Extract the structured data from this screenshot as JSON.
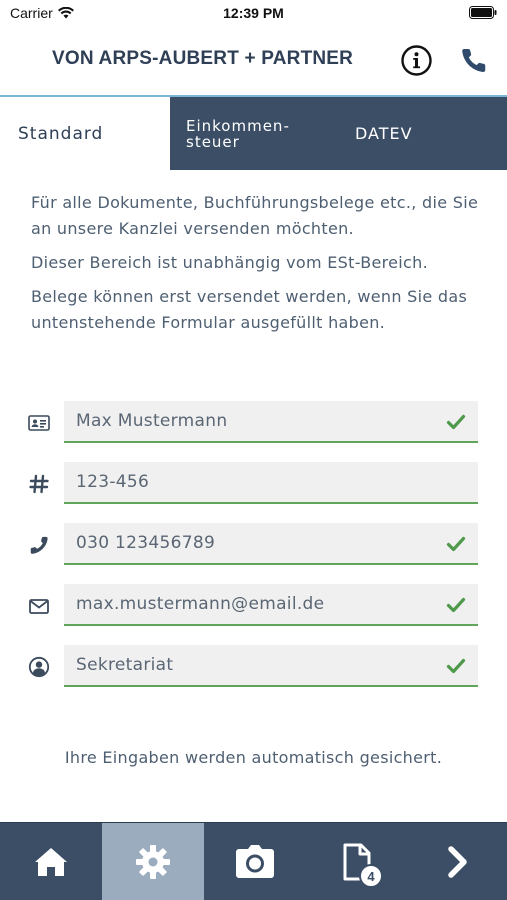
{
  "status_bar": {
    "carrier": "Carrier",
    "time": "12:39 PM"
  },
  "header": {
    "brand": "VON ARPS-AUBERT + PARTNER",
    "info_icon": "info-icon",
    "phone_icon": "phone-icon"
  },
  "tabs": [
    {
      "label": "Standard",
      "active": true
    },
    {
      "label": "Einkommen-\nsteuer",
      "active": false
    },
    {
      "label": "DATEV",
      "active": false
    }
  ],
  "intro": {
    "p1": "Für alle Dokumente, Buchführungsbelege etc., die Sie an unsere Kanzlei versenden möchten.",
    "p2": "Dieser Bereich ist unabhängig vom ESt-Bereich.",
    "p3": "Belege können erst versendet werden, wenn Sie das untenstehende Formular ausgefüllt haben."
  },
  "form": {
    "name": {
      "value": "Max Mustermann",
      "icon": "id-card-icon",
      "valid": true
    },
    "number": {
      "value": "123-456",
      "icon": "hash-icon",
      "valid": false
    },
    "phone": {
      "value": "030 123456789",
      "icon": "phone-icon",
      "valid": true
    },
    "email": {
      "value": "max.mustermann@email.de",
      "icon": "envelope-icon",
      "valid": true
    },
    "role": {
      "value": "Sekretariat",
      "icon": "user-circle-icon",
      "valid": true
    }
  },
  "autosave_note": "Ihre Eingaben werden automatisch gesichert.",
  "bottom_nav": {
    "items": [
      "home-icon",
      "gear-icon",
      "camera-icon",
      "document-icon",
      "chevron-right-icon"
    ],
    "active": "gear-icon",
    "document_badge": "4"
  },
  "colors": {
    "primary": "#3b4e66",
    "accent": "#7bb6d6",
    "success": "#4f9a4a",
    "active_nav": "#9aacbe"
  }
}
